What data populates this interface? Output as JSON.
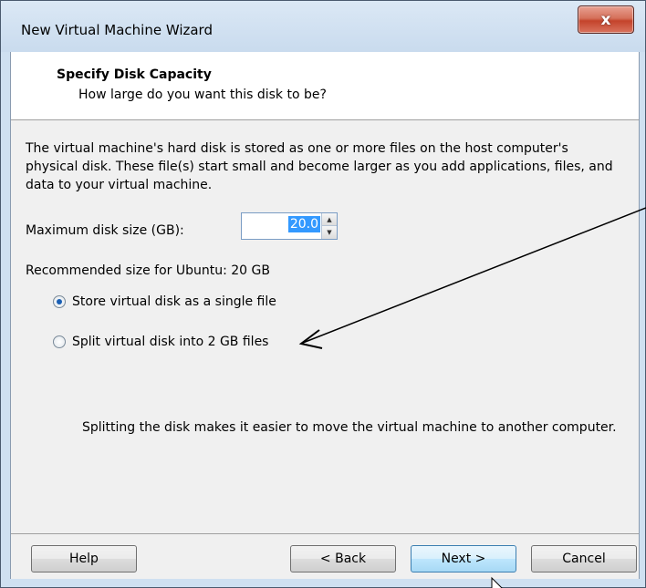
{
  "window": {
    "title": "New Virtual Machine Wizard",
    "close_label": "x"
  },
  "header": {
    "title": "Specify Disk Capacity",
    "subtitle": "How large do you want this disk to be?"
  },
  "body": {
    "description": "The virtual machine's hard disk is stored as one or more files on the host computer's physical disk. These file(s) start small and become larger as you add applications, files, and data to your virtual machine.",
    "disk_size_label": "Maximum disk size (GB):",
    "disk_size_value": "20.0",
    "recommended": "Recommended size for Ubuntu: 20 GB",
    "options": [
      {
        "label": "Store virtual disk as a single file",
        "checked": true
      },
      {
        "label": "Split virtual disk into 2 GB files",
        "checked": false
      }
    ],
    "split_description": "Splitting the disk makes it easier to move the virtual machine to another computer."
  },
  "buttons": {
    "help": "Help",
    "back": "< Back",
    "next": "Next >",
    "cancel": "Cancel"
  }
}
